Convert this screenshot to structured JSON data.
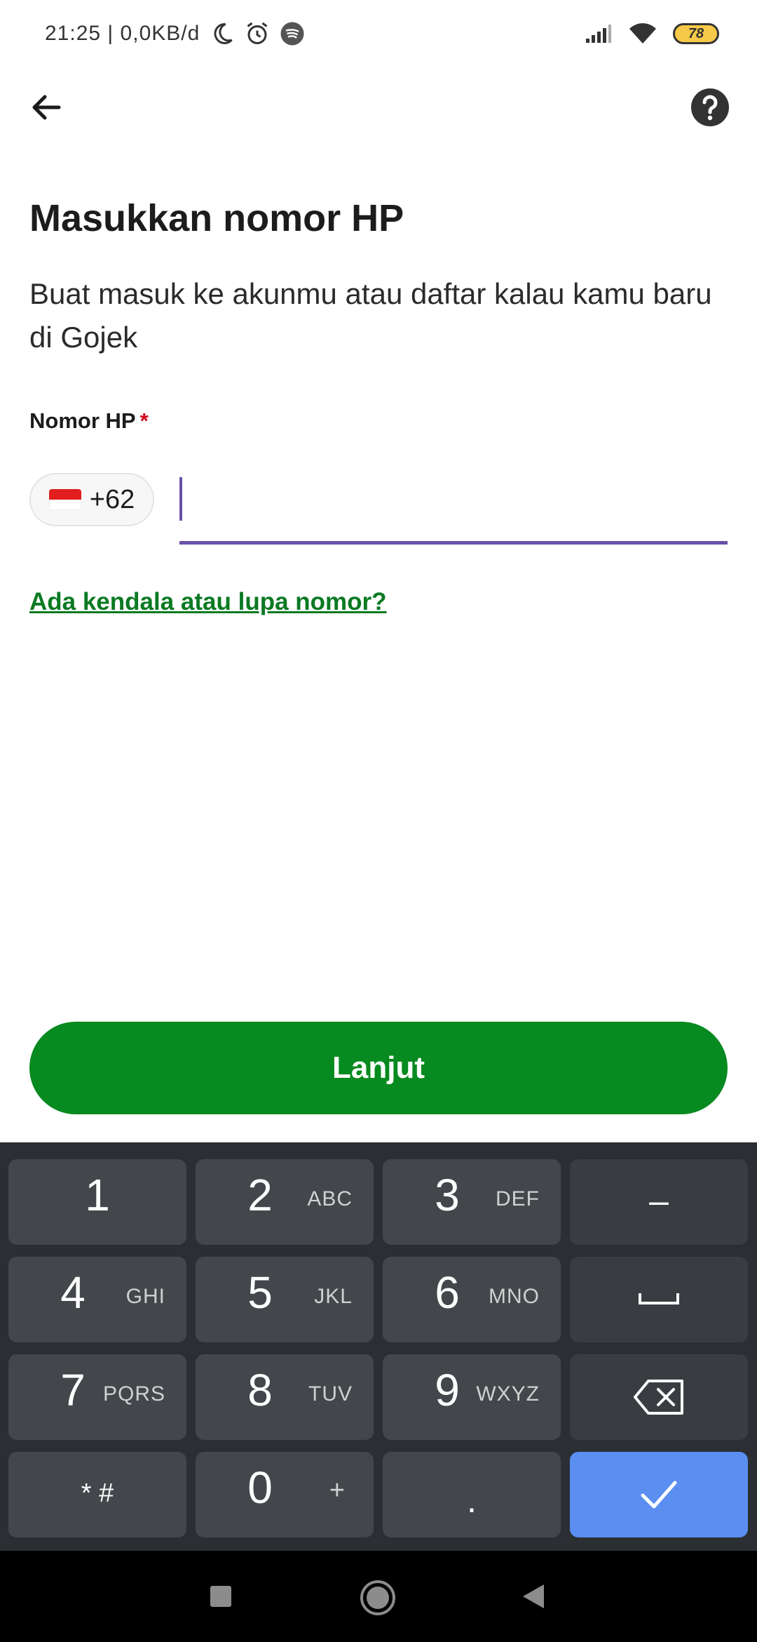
{
  "status_bar": {
    "time": "21:25",
    "network_speed": "0,0KB/d",
    "battery": "78",
    "icons": [
      "moon-icon",
      "alarm-icon",
      "spotify-icon",
      "signal-icon",
      "wifi-icon",
      "battery-icon"
    ]
  },
  "header": {
    "back_icon": "arrow-left-icon",
    "help_icon": "question-icon"
  },
  "content": {
    "title": "Masukkan nomor HP",
    "subtitle": "Buat masuk ke akunmu atau daftar kalau kamu baru di Gojek",
    "phone_label": "Nomor HP",
    "required_mark": "*",
    "country_code": "+62",
    "country_flag": "indonesia-flag-icon",
    "phone_value": "",
    "help_link": "Ada kendala atau lupa nomor?",
    "continue_button": "Lanjut"
  },
  "keyboard": {
    "keys": [
      {
        "num": "1",
        "letters": ""
      },
      {
        "num": "2",
        "letters": "ABC"
      },
      {
        "num": "3",
        "letters": "DEF"
      },
      {
        "num": "4",
        "letters": "GHI"
      },
      {
        "num": "5",
        "letters": "JKL"
      },
      {
        "num": "6",
        "letters": "MNO"
      },
      {
        "num": "7",
        "letters": "PQRS"
      },
      {
        "num": "8",
        "letters": "TUV"
      },
      {
        "num": "9",
        "letters": "WXYZ"
      },
      {
        "num": "0",
        "letters": "+"
      }
    ],
    "minus": "–",
    "star_hash": "* #",
    "dot": "."
  },
  "colors": {
    "primary_green": "#078a1f",
    "link_green": "#0b7a23",
    "input_underline": "#6a51a8",
    "keyboard_bg": "#2b2f33",
    "key_bg": "#43474b",
    "done_key": "#5a8ef0"
  }
}
